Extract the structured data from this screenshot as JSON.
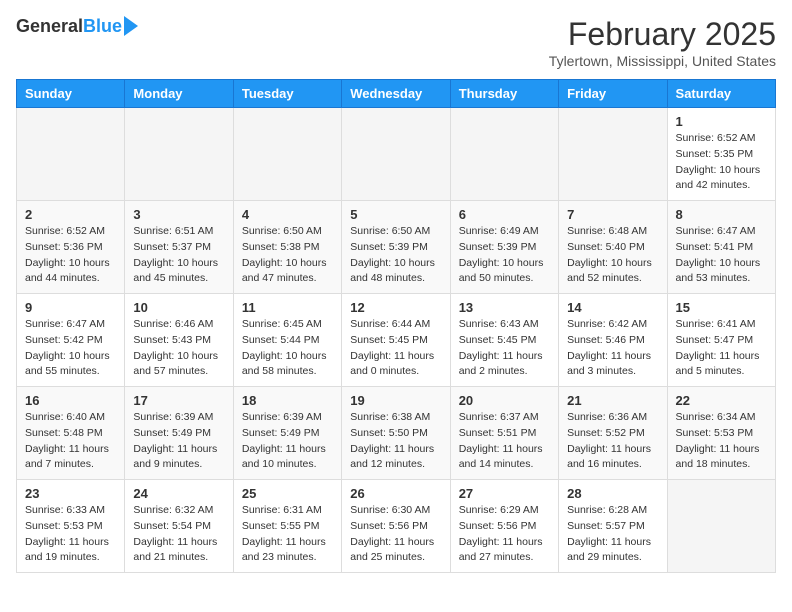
{
  "header": {
    "logo_general": "General",
    "logo_blue": "Blue",
    "title": "February 2025",
    "subtitle": "Tylertown, Mississippi, United States"
  },
  "calendar": {
    "days_of_week": [
      "Sunday",
      "Monday",
      "Tuesday",
      "Wednesday",
      "Thursday",
      "Friday",
      "Saturday"
    ],
    "weeks": [
      [
        {
          "day": "",
          "info": ""
        },
        {
          "day": "",
          "info": ""
        },
        {
          "day": "",
          "info": ""
        },
        {
          "day": "",
          "info": ""
        },
        {
          "day": "",
          "info": ""
        },
        {
          "day": "",
          "info": ""
        },
        {
          "day": "1",
          "info": "Sunrise: 6:52 AM\nSunset: 5:35 PM\nDaylight: 10 hours and 42 minutes."
        }
      ],
      [
        {
          "day": "2",
          "info": "Sunrise: 6:52 AM\nSunset: 5:36 PM\nDaylight: 10 hours and 44 minutes."
        },
        {
          "day": "3",
          "info": "Sunrise: 6:51 AM\nSunset: 5:37 PM\nDaylight: 10 hours and 45 minutes."
        },
        {
          "day": "4",
          "info": "Sunrise: 6:50 AM\nSunset: 5:38 PM\nDaylight: 10 hours and 47 minutes."
        },
        {
          "day": "5",
          "info": "Sunrise: 6:50 AM\nSunset: 5:39 PM\nDaylight: 10 hours and 48 minutes."
        },
        {
          "day": "6",
          "info": "Sunrise: 6:49 AM\nSunset: 5:39 PM\nDaylight: 10 hours and 50 minutes."
        },
        {
          "day": "7",
          "info": "Sunrise: 6:48 AM\nSunset: 5:40 PM\nDaylight: 10 hours and 52 minutes."
        },
        {
          "day": "8",
          "info": "Sunrise: 6:47 AM\nSunset: 5:41 PM\nDaylight: 10 hours and 53 minutes."
        }
      ],
      [
        {
          "day": "9",
          "info": "Sunrise: 6:47 AM\nSunset: 5:42 PM\nDaylight: 10 hours and 55 minutes."
        },
        {
          "day": "10",
          "info": "Sunrise: 6:46 AM\nSunset: 5:43 PM\nDaylight: 10 hours and 57 minutes."
        },
        {
          "day": "11",
          "info": "Sunrise: 6:45 AM\nSunset: 5:44 PM\nDaylight: 10 hours and 58 minutes."
        },
        {
          "day": "12",
          "info": "Sunrise: 6:44 AM\nSunset: 5:45 PM\nDaylight: 11 hours and 0 minutes."
        },
        {
          "day": "13",
          "info": "Sunrise: 6:43 AM\nSunset: 5:45 PM\nDaylight: 11 hours and 2 minutes."
        },
        {
          "day": "14",
          "info": "Sunrise: 6:42 AM\nSunset: 5:46 PM\nDaylight: 11 hours and 3 minutes."
        },
        {
          "day": "15",
          "info": "Sunrise: 6:41 AM\nSunset: 5:47 PM\nDaylight: 11 hours and 5 minutes."
        }
      ],
      [
        {
          "day": "16",
          "info": "Sunrise: 6:40 AM\nSunset: 5:48 PM\nDaylight: 11 hours and 7 minutes."
        },
        {
          "day": "17",
          "info": "Sunrise: 6:39 AM\nSunset: 5:49 PM\nDaylight: 11 hours and 9 minutes."
        },
        {
          "day": "18",
          "info": "Sunrise: 6:39 AM\nSunset: 5:49 PM\nDaylight: 11 hours and 10 minutes."
        },
        {
          "day": "19",
          "info": "Sunrise: 6:38 AM\nSunset: 5:50 PM\nDaylight: 11 hours and 12 minutes."
        },
        {
          "day": "20",
          "info": "Sunrise: 6:37 AM\nSunset: 5:51 PM\nDaylight: 11 hours and 14 minutes."
        },
        {
          "day": "21",
          "info": "Sunrise: 6:36 AM\nSunset: 5:52 PM\nDaylight: 11 hours and 16 minutes."
        },
        {
          "day": "22",
          "info": "Sunrise: 6:34 AM\nSunset: 5:53 PM\nDaylight: 11 hours and 18 minutes."
        }
      ],
      [
        {
          "day": "23",
          "info": "Sunrise: 6:33 AM\nSunset: 5:53 PM\nDaylight: 11 hours and 19 minutes."
        },
        {
          "day": "24",
          "info": "Sunrise: 6:32 AM\nSunset: 5:54 PM\nDaylight: 11 hours and 21 minutes."
        },
        {
          "day": "25",
          "info": "Sunrise: 6:31 AM\nSunset: 5:55 PM\nDaylight: 11 hours and 23 minutes."
        },
        {
          "day": "26",
          "info": "Sunrise: 6:30 AM\nSunset: 5:56 PM\nDaylight: 11 hours and 25 minutes."
        },
        {
          "day": "27",
          "info": "Sunrise: 6:29 AM\nSunset: 5:56 PM\nDaylight: 11 hours and 27 minutes."
        },
        {
          "day": "28",
          "info": "Sunrise: 6:28 AM\nSunset: 5:57 PM\nDaylight: 11 hours and 29 minutes."
        },
        {
          "day": "",
          "info": ""
        }
      ]
    ]
  }
}
